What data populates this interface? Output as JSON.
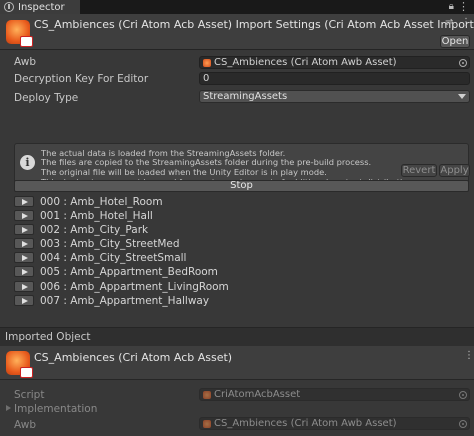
{
  "tab": {
    "label": "Inspector"
  },
  "header": {
    "title": "CS_Ambiences (Cri Atom Acb Asset) Import Settings (Cri Atom Acb Asset Importer)",
    "open_label": "Open"
  },
  "fields": {
    "awb_label": "Awb",
    "awb_value": "CS_Ambiences (Cri Atom Awb Asset)",
    "decryption_label": "Decryption Key For Editor",
    "decryption_value": "0",
    "deploy_label": "Deploy Type",
    "deploy_value": "StreamingAssets"
  },
  "info": {
    "icon": "i",
    "lines": [
      "The actual data is loaded from the StreamingAssets folder.",
      "The files are copied to the StreamingAssets folder during the pre-build process.",
      "The original file will be loaded when the Unity Editor is in play mode.",
      "This deploy type cannot be used for assets used as part of additional content distribution."
    ]
  },
  "buttons": {
    "revert": "Revert",
    "apply": "Apply",
    "stop": "Stop"
  },
  "cues": [
    "000 : Amb_Hotel_Room",
    "001 : Amb_Hotel_Hall",
    "002 : Amb_City_Park",
    "003 : Amb_City_StreetMed",
    "004 : Amb_City_StreetSmall",
    "005 : Amb_Appartment_BedRoom",
    "006 : Amb_Appartment_LivingRoom",
    "007 : Amb_Appartment_Hallway"
  ],
  "imported": {
    "section_label": "Imported Object",
    "title": "CS_Ambiences (Cri Atom Acb Asset)",
    "script_label": "Script",
    "script_value": "CriAtomAcbAsset",
    "implementation_label": "Implementation",
    "awb_label": "Awb",
    "awb_value": "CS_Ambiences (Cri Atom Awb Asset)"
  },
  "icons": {
    "tab": "info-icon",
    "lock": "lock-icon",
    "menu": "kebab-menu-icon",
    "settings": "sliders-icon",
    "more": "more-icon"
  }
}
